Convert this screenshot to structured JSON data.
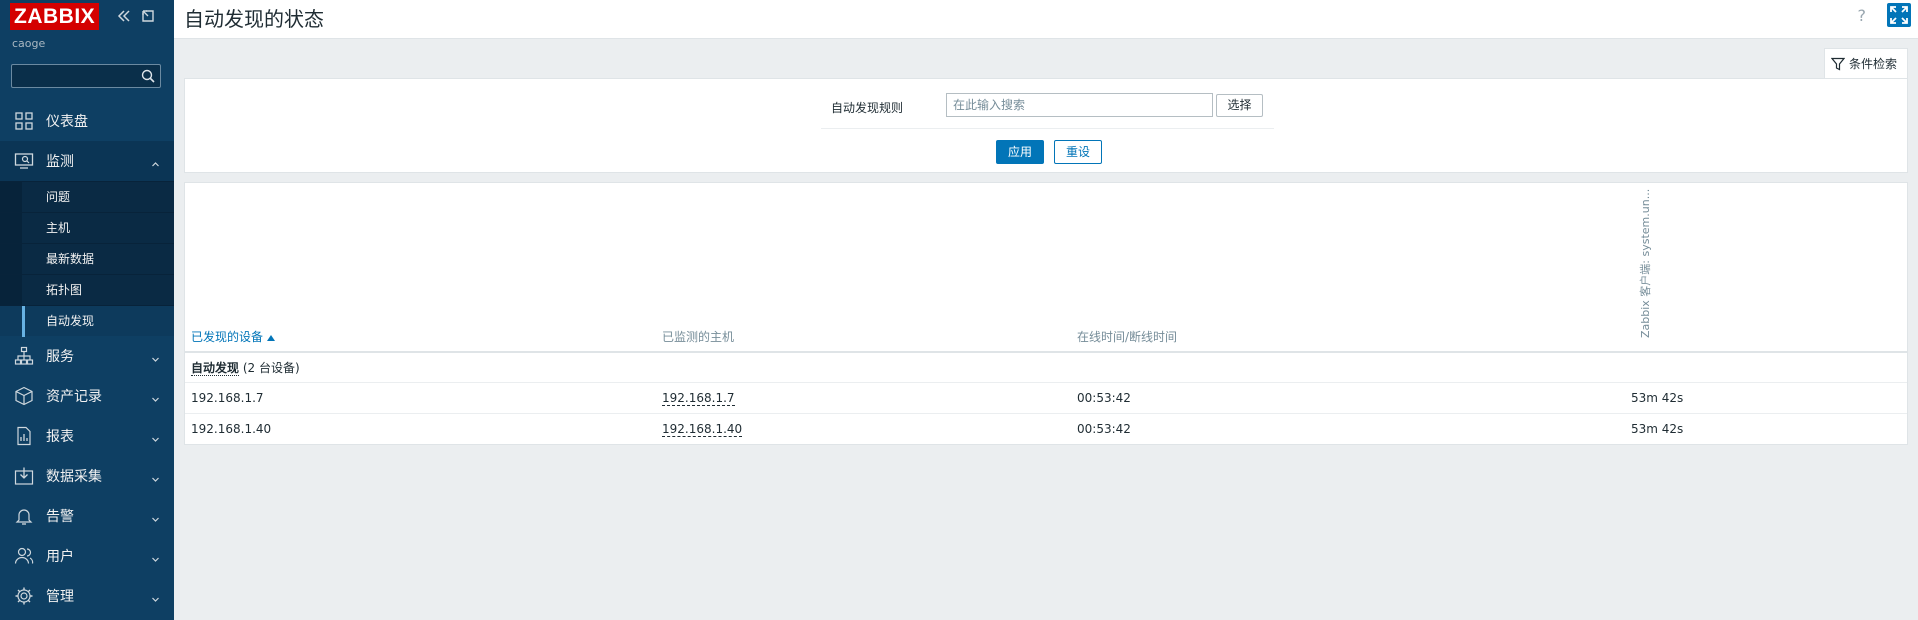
{
  "sidebar": {
    "logo": "ZABBIX",
    "server_name": "caoge",
    "search_placeholder": "",
    "menu": [
      {
        "label": "仪表盘",
        "icon": "dashboard-icon"
      },
      {
        "label": "监测",
        "icon": "monitoring-icon",
        "expanded": true,
        "children": [
          "问题",
          "主机",
          "最新数据",
          "拓扑图",
          "自动发现"
        ],
        "selected_child": "自动发现"
      },
      {
        "label": "服务",
        "icon": "services-icon"
      },
      {
        "label": "资产记录",
        "icon": "inventory-icon"
      },
      {
        "label": "报表",
        "icon": "reports-icon"
      },
      {
        "label": "数据采集",
        "icon": "data-collection-icon"
      },
      {
        "label": "告警",
        "icon": "alerts-icon"
      },
      {
        "label": "用户",
        "icon": "users-icon"
      },
      {
        "label": "管理",
        "icon": "administration-icon"
      }
    ]
  },
  "header": {
    "title": "自动发现的状态",
    "help": "?"
  },
  "filter": {
    "tab_label": "条件检索",
    "rule_label": "自动发现规则",
    "rule_placeholder": "在此输入搜索",
    "select_label": "选择",
    "apply_label": "应用",
    "reset_label": "重设"
  },
  "table": {
    "columns": [
      "已发现的设备",
      "已监测的主机",
      "在线时间/断线时间",
      "Zabbix 客户端: system.un..."
    ],
    "group": {
      "name": "自动发现",
      "count": "(2 台设备)"
    },
    "rows": [
      {
        "device": "192.168.1.7",
        "host": "192.168.1.7",
        "uptime": "00:53:42",
        "check": "53m 42s"
      },
      {
        "device": "192.168.1.40",
        "host": "192.168.1.40",
        "uptime": "00:53:42",
        "check": "53m 42s"
      }
    ]
  },
  "colors": {
    "sidebar_bg": "#0e3f63",
    "accent": "#0275b8",
    "logo_red": "#d40000"
  }
}
